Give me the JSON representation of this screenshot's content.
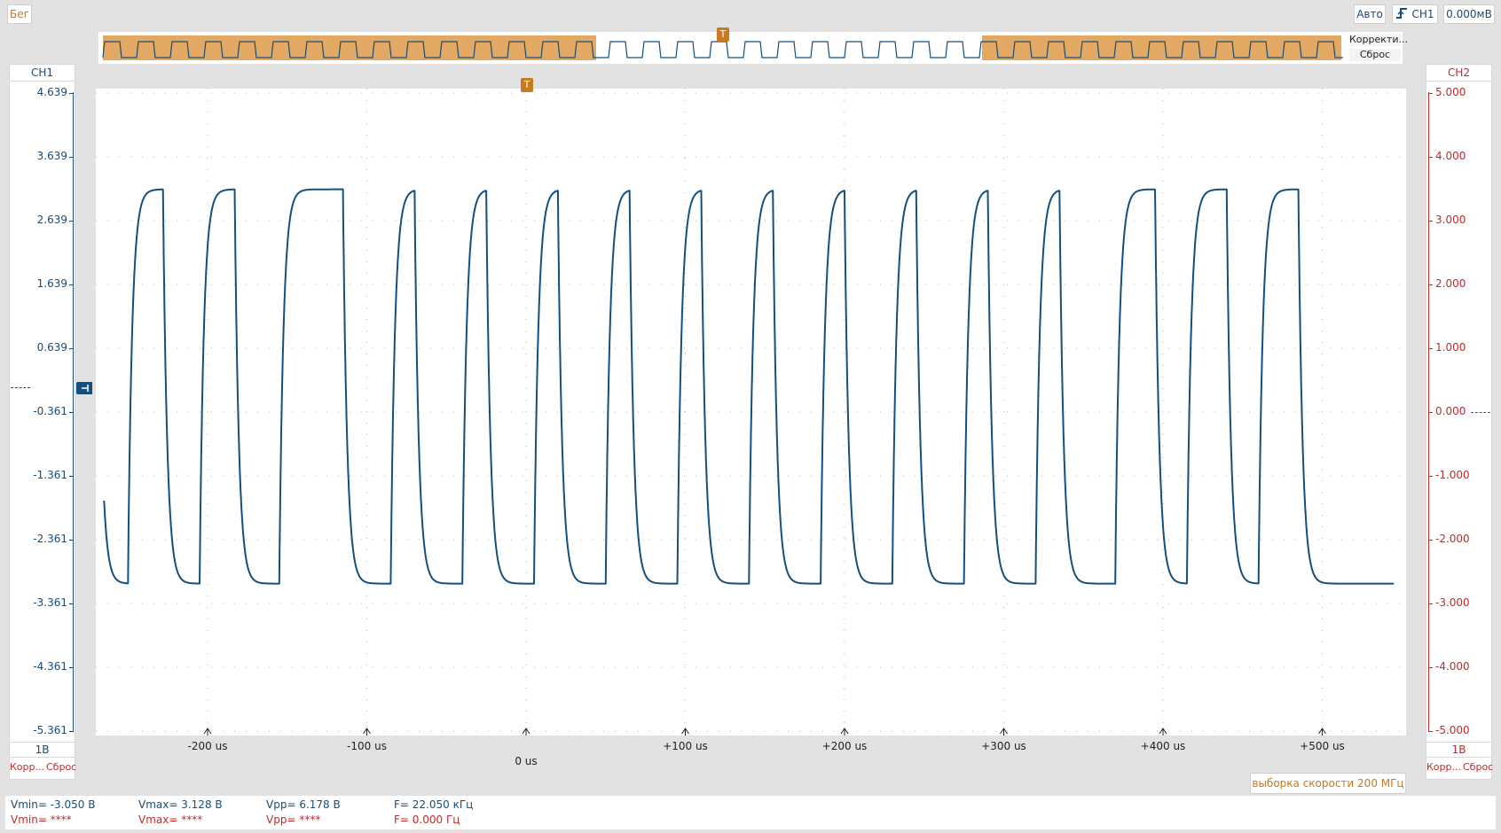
{
  "status": {
    "run_label": "Бег"
  },
  "top_right": {
    "mode": "Авто",
    "trigger_channel": "CH1",
    "trigger_level": "0.000мВ"
  },
  "overview": {
    "correct_label": "Корректи...",
    "reset_label": "Сброс"
  },
  "trigger_marker": "T",
  "ch1": {
    "title": "CH1",
    "scale": "1В",
    "correct": "Корр...",
    "reset": "Сброс",
    "ticks": [
      "4.639",
      "3.639",
      "2.639",
      "1.639",
      "0.639",
      "-0.361",
      "-1.361",
      "-2.361",
      "-3.361",
      "-4.361",
      "-5.361"
    ]
  },
  "ch2": {
    "title": "CH2",
    "scale": "1В",
    "correct": "Корр...",
    "reset": "Сброс",
    "ticks": [
      "5.000",
      "4.000",
      "3.000",
      "2.000",
      "1.000",
      "0.000",
      "-1.000",
      "-2.000",
      "-3.000",
      "-4.000",
      "-5.000"
    ]
  },
  "xaxis": {
    "labels": [
      "-200 us",
      "-100 us",
      "0 us",
      "+100 us",
      "+200 us",
      "+300 us",
      "+400 us",
      "+500 us"
    ]
  },
  "sample_rate": "выборка скорости 200 МГц",
  "measurements": {
    "row1": {
      "vmin": "Vmin= -3.050 В",
      "vmax": "Vmax= 3.128 В",
      "vpp": "Vpp= 6.178 В",
      "freq": "F= 22.050 кГц"
    },
    "row2": {
      "vmin": "Vmin= ****",
      "vmax": "Vmax= ****",
      "vpp": "Vpp= ****",
      "freq": "F= 0.000 Гц"
    }
  },
  "colors": {
    "trace": "#13507f",
    "ch2": "#c42a2a",
    "accent": "#c87a1e",
    "overview_fill": "#e3a862"
  },
  "chart_data": {
    "type": "line",
    "title": "",
    "xlabel": "",
    "ylabel": "",
    "xlim": [
      -265,
      555
    ],
    "ylim": [
      -5.361,
      4.639
    ],
    "x_unit": "us",
    "rising_edges_us": [
      -250,
      -205,
      -155,
      -85,
      -40,
      5,
      50,
      95,
      140,
      185,
      230,
      275,
      320,
      370,
      415,
      460
    ],
    "falling_edges_us": [
      -228,
      -183,
      -115,
      -70,
      -25,
      20,
      65,
      110,
      155,
      200,
      245,
      290,
      335,
      395,
      440,
      485
    ],
    "high_v": 3.13,
    "low_v": -3.05,
    "series": [
      {
        "name": "CH1",
        "color": "#13507f"
      }
    ]
  }
}
